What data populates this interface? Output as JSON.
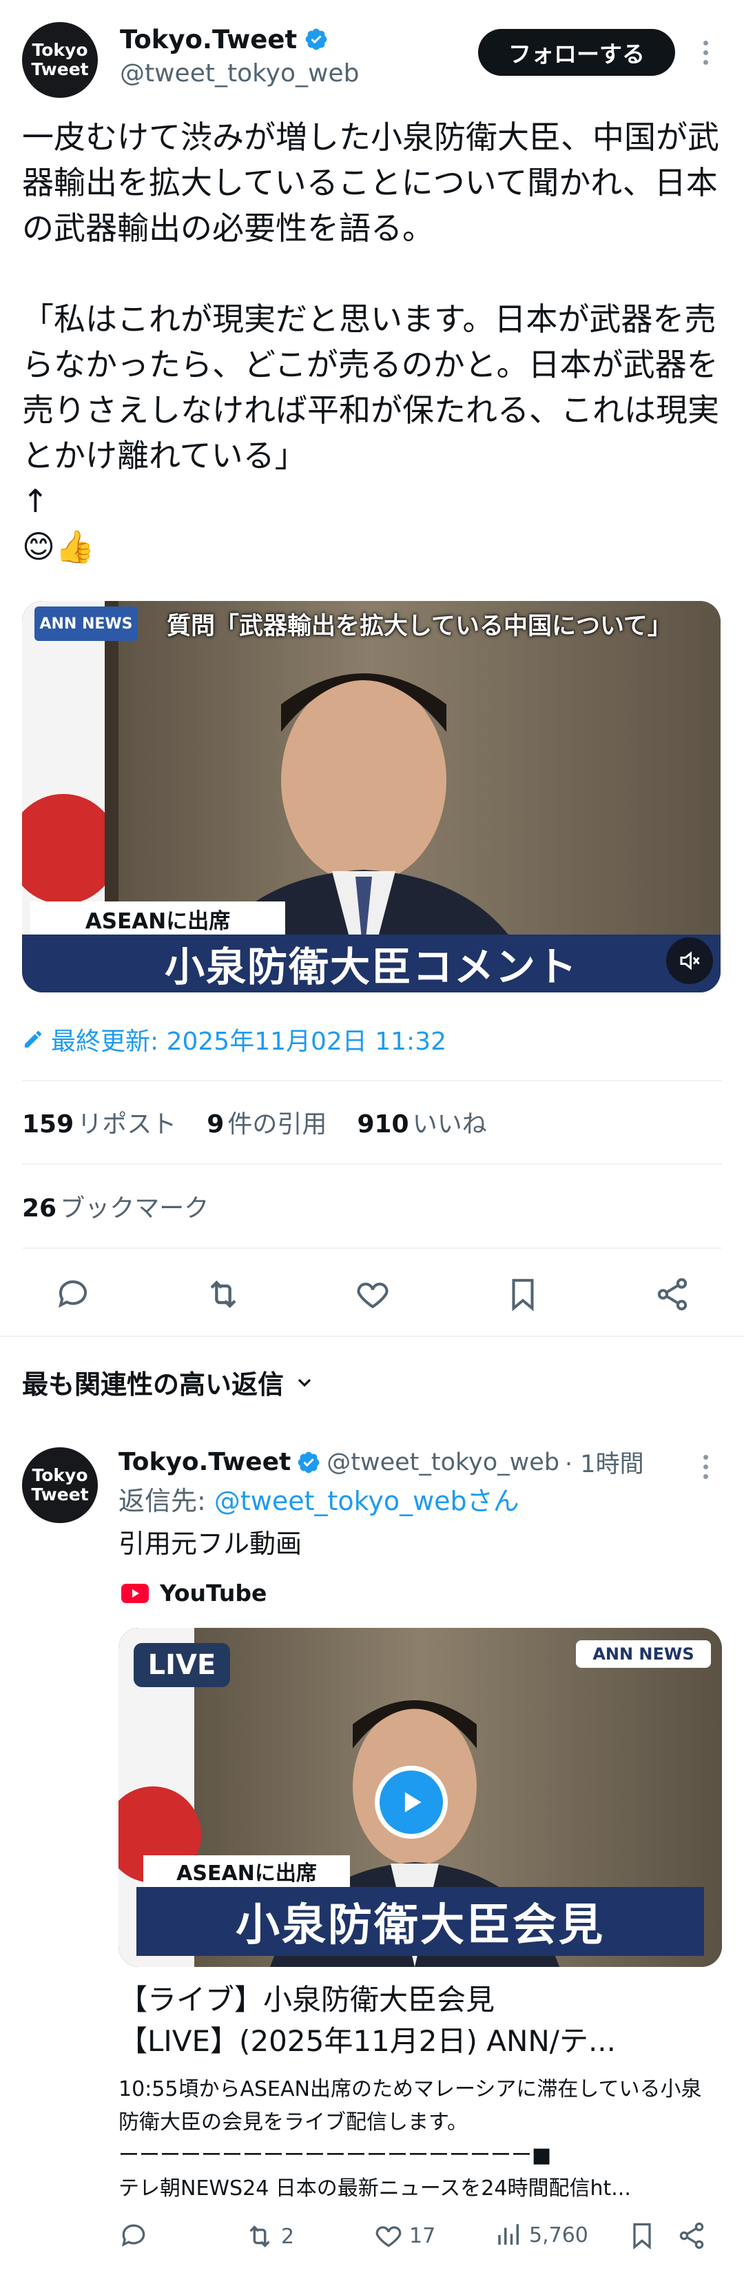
{
  "author": {
    "name": "Tokyo.Tweet",
    "handle": "@tweet_tokyo_web",
    "avatar_line1": "Tokyo",
    "avatar_line2": "Tweet"
  },
  "follow_label": "フォローする",
  "tweet": {
    "text": "一皮むけて渋みが増した小泉防衛大臣、中国が武器輸出を拡大していることについて聞かれ、日本の武器輸出の必要性を語る。\n\n「私はこれが現実だと思います。日本が武器を売らなかったら、どこが売るのかと。日本が武器を売りさえしなければ平和が保たれる、これは現実とかけ離れている」\n↑\n😊👍"
  },
  "video": {
    "caption_top": "質問「武器輸出を拡大している中国について」",
    "ann_logo": "ANN NEWS",
    "sub_label": "ASEANに出席",
    "main_label": "小泉防衛大臣コメント"
  },
  "last_updated": "最終更新: 2025年11月02日 11:32",
  "stats": {
    "reposts_num": "159",
    "reposts_lbl": "リポスト",
    "quotes_num": "9",
    "quotes_lbl": "件の引用",
    "likes_num": "910",
    "likes_lbl": "いいね",
    "bookmarks_num": "26",
    "bookmarks_lbl": "ブックマーク"
  },
  "replies_sort_label": "最も関連性の高い返信",
  "reply": {
    "name": "Tokyo.Tweet",
    "handle": "@tweet_tokyo_web",
    "time": "· 1時間",
    "replying_prefix": "返信先: ",
    "replying_to": "@tweet_tokyo_webさん",
    "text": "引用元フル動画",
    "youtube_label": "YouTube",
    "card": {
      "live_badge": "LIVE",
      "ann_logo": "ANN NEWS",
      "sub_label": "ASEANに出席",
      "main_label": "小泉防衛大臣会見",
      "title": "【ライブ】小泉防衛大臣会見\n【LIVE】(2025年11月2日) ANN/テ...",
      "desc": "10:55頃からASEAN出席のためマレーシアに滞在している小泉防衛大臣の会見をライブ配信します。\nーーーーーーーーーーーーーーーーーーーー■\nテレ朝NEWS24 日本の最新ニュースを24時間配信ht..."
    },
    "actions": {
      "reposts": "2",
      "likes": "17",
      "views": "5,760"
    }
  },
  "colors": {
    "accent": "#1d9bf0",
    "text": "#0f1419",
    "muted": "#536471",
    "divider": "#eff3f4",
    "banner_blue": "#1f3468"
  }
}
